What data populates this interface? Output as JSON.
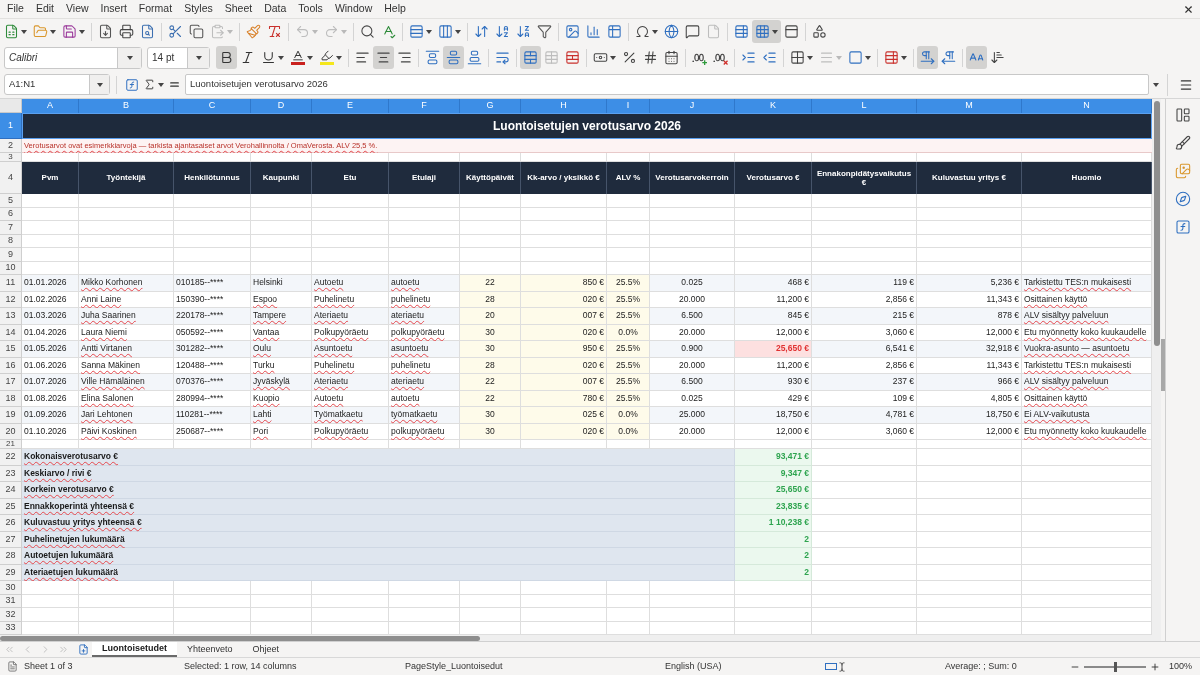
{
  "menu": [
    "File",
    "Edit",
    "View",
    "Insert",
    "Format",
    "Styles",
    "Sheet",
    "Data",
    "Tools",
    "Window",
    "Help"
  ],
  "standard_toolbar": {
    "disabled": {
      "paste": true,
      "undo": true,
      "redo": true,
      "headers_footers": true
    },
    "pressed": {
      "freeze_rows_columns": true
    }
  },
  "formatting_toolbar": {
    "font_name": "Calibri",
    "font_size": "14 pt",
    "pressed": {
      "bold": true,
      "italic": false,
      "underline": false,
      "align_left": false,
      "align_center": true,
      "align_right": false,
      "align_top": false,
      "center_vertically": true,
      "align_bottom": false,
      "wrap_text": false,
      "merge_and_center": true,
      "left_to_right": true,
      "right_to_left": false,
      "text_horizontal": true,
      "text_vertical": false
    },
    "disabled": {
      "merge_cells": true,
      "border_style": true
    }
  },
  "formula_bar": {
    "name_box": "A1:N1",
    "content": "Luontoisetujen verotusarvo 2026"
  },
  "sheet": {
    "columns": [
      {
        "letter": "A",
        "selected": true,
        "input": false
      },
      {
        "letter": "B",
        "selected": true,
        "input": false
      },
      {
        "letter": "C",
        "selected": true,
        "input": false
      },
      {
        "letter": "D",
        "selected": true,
        "input": false
      },
      {
        "letter": "E",
        "selected": true,
        "input": false
      },
      {
        "letter": "F",
        "selected": true,
        "input": false
      },
      {
        "letter": "G",
        "selected": true,
        "input": true
      },
      {
        "letter": "H",
        "selected": true,
        "input": true
      },
      {
        "letter": "I",
        "selected": true,
        "input": true
      },
      {
        "letter": "J",
        "selected": true,
        "input": false
      },
      {
        "letter": "K",
        "selected": true,
        "input": false
      },
      {
        "letter": "L",
        "selected": true,
        "input": false
      },
      {
        "letter": "M",
        "selected": true,
        "input": false
      },
      {
        "letter": "N",
        "selected": true,
        "input": false
      }
    ],
    "rows": [
      {
        "number": "1",
        "kind": "title",
        "selected": true,
        "text": "Luontoisetujen verotusarvo 2026"
      },
      {
        "number": "2",
        "kind": "note",
        "selected": false,
        "misspelled": true,
        "text": "Verotusarvot ovat esimerkkiarvoja — tarkista ajantasaiset arvot Verohallinnolta / OmaVerosta. ALV 25,5 %."
      },
      {
        "number": "3",
        "kind": "spacer",
        "selected": false
      },
      {
        "number": "4",
        "kind": "header",
        "selected": false,
        "cells": [
          "Pvm",
          "Työntekijä",
          "Henkilötunnus",
          "Kaupunki",
          "Etu",
          "Etulaji",
          "Käyttöpäivät",
          "Kk-arvo / yksikkö €",
          "ALV %",
          "Verotusarvokerroin",
          "Verotusarvo €",
          "Ennakonpidätysvaikutus €",
          "Kuluvastuu yritys €",
          "Huomio"
        ]
      },
      {
        "number": "5",
        "kind": "empty",
        "selected": false
      },
      {
        "number": "6",
        "kind": "empty",
        "selected": false
      },
      {
        "number": "7",
        "kind": "empty",
        "selected": false
      },
      {
        "number": "8",
        "kind": "empty",
        "selected": false
      },
      {
        "number": "9",
        "kind": "empty",
        "selected": false
      },
      {
        "number": "10",
        "kind": "empty",
        "selected": false
      },
      {
        "number": "11",
        "kind": "data",
        "selected": false,
        "shaded": true,
        "misspelled": [
          false,
          true,
          false,
          false,
          true,
          true,
          false,
          false,
          false,
          false,
          false,
          false,
          false,
          true
        ],
        "cells": [
          "01.01.2026",
          "Mikko Korhonen",
          "010185--****",
          "Helsinki",
          "Autoetu",
          "autoetu",
          "22",
          "850 €",
          "25.5%",
          "0.025",
          "468 €",
          "119 €",
          "5,236 €",
          "Tarkistettu TES:n mukaisesti"
        ]
      },
      {
        "number": "12",
        "kind": "data",
        "selected": false,
        "shaded": false,
        "misspelled": [
          false,
          true,
          false,
          true,
          true,
          true,
          false,
          false,
          false,
          false,
          false,
          false,
          false,
          true
        ],
        "cells": [
          "01.02.2026",
          "Anni Laine",
          "150390--****",
          "Espoo",
          "Puhelinetu",
          "puhelinetu",
          "28",
          "020 €",
          "25.5%",
          "20.000",
          "11,200 €",
          "2,856 €",
          "11,343 €",
          "Osittainen käyttö"
        ]
      },
      {
        "number": "13",
        "kind": "data",
        "selected": false,
        "shaded": true,
        "misspelled": [
          false,
          true,
          false,
          true,
          true,
          true,
          false,
          false,
          false,
          false,
          false,
          false,
          false,
          true
        ],
        "cells": [
          "01.03.2026",
          "Juha Saarinen",
          "220178--****",
          "Tampere",
          "Ateriaetu",
          "ateriaetu",
          "20",
          "007 €",
          "25.5%",
          "6.500",
          "845 €",
          "215 €",
          "878 €",
          "ALV sisältyy palveluun"
        ]
      },
      {
        "number": "14",
        "kind": "data",
        "selected": false,
        "shaded": false,
        "misspelled": [
          false,
          true,
          false,
          true,
          true,
          true,
          false,
          false,
          false,
          false,
          false,
          false,
          false,
          true
        ],
        "cells": [
          "01.04.2026",
          "Laura Niemi",
          "050592--****",
          "Vantaa",
          "Polkupyöräetu",
          "polkupyöräetu",
          "30",
          "020 €",
          "0.0%",
          "20.000",
          "12,000 €",
          "3,060 €",
          "12,000 €",
          "Etu myönnetty koko kuukaudelle"
        ]
      },
      {
        "number": "15",
        "kind": "data",
        "selected": false,
        "shaded": true,
        "misspelled": [
          false,
          true,
          false,
          true,
          true,
          true,
          false,
          false,
          false,
          false,
          false,
          false,
          false,
          true
        ],
        "alert": [
          false,
          false,
          false,
          false,
          false,
          false,
          false,
          false,
          false,
          false,
          true,
          false,
          false,
          false
        ],
        "cells": [
          "01.05.2026",
          "Antti Virtanen",
          "301282--****",
          "Oulu",
          "Asuntoetu",
          "asuntoetu",
          "30",
          "950 €",
          "25.5%",
          "0.900",
          "25,650 €",
          "6,541 €",
          "32,918 €",
          "Vuokra-asunto — asuntoetu"
        ]
      },
      {
        "number": "16",
        "kind": "data",
        "selected": false,
        "shaded": false,
        "misspelled": [
          false,
          true,
          false,
          true,
          true,
          true,
          false,
          false,
          false,
          false,
          false,
          false,
          false,
          true
        ],
        "cells": [
          "01.06.2026",
          "Sanna Mäkinen",
          "120488--****",
          "Turku",
          "Puhelinetu",
          "puhelinetu",
          "28",
          "020 €",
          "25.5%",
          "20.000",
          "11,200 €",
          "2,856 €",
          "11,343 €",
          "Tarkistettu TES:n mukaisesti"
        ]
      },
      {
        "number": "17",
        "kind": "data",
        "selected": false,
        "shaded": true,
        "misspelled": [
          false,
          true,
          false,
          true,
          true,
          true,
          false,
          false,
          false,
          false,
          false,
          false,
          false,
          true
        ],
        "cells": [
          "01.07.2026",
          "Ville Hämäläinen",
          "070376--****",
          "Jyväskylä",
          "Ateriaetu",
          "ateriaetu",
          "22",
          "007 €",
          "25.5%",
          "6.500",
          "930 €",
          "237 €",
          "966 €",
          "ALV sisältyy palveluun"
        ]
      },
      {
        "number": "18",
        "kind": "data",
        "selected": false,
        "shaded": false,
        "misspelled": [
          false,
          true,
          false,
          true,
          true,
          true,
          false,
          false,
          false,
          false,
          false,
          false,
          false,
          true
        ],
        "cells": [
          "01.08.2026",
          "Elina Salonen",
          "280994--****",
          "Kuopio",
          "Autoetu",
          "autoetu",
          "22",
          "780 €",
          "25.5%",
          "0.025",
          "429 €",
          "109 €",
          "4,805 €",
          "Osittainen käyttö"
        ]
      },
      {
        "number": "19",
        "kind": "data",
        "selected": false,
        "shaded": true,
        "misspelled": [
          false,
          true,
          false,
          true,
          true,
          true,
          false,
          false,
          false,
          false,
          false,
          false,
          false,
          true
        ],
        "cells": [
          "01.09.2026",
          "Jari Lehtonen",
          "110281--****",
          "Lahti",
          "Työmatkaetu",
          "työmatkaetu",
          "30",
          "025 €",
          "0.0%",
          "25.000",
          "18,750 €",
          "4,781 €",
          "18,750 €",
          "Ei ALV-vaikutusta"
        ]
      },
      {
        "number": "20",
        "kind": "data",
        "selected": false,
        "shaded": false,
        "misspelled": [
          false,
          true,
          false,
          true,
          true,
          true,
          false,
          false,
          false,
          false,
          false,
          false,
          false,
          true
        ],
        "cells": [
          "01.10.2026",
          "Päivi Koskinen",
          "250687--****",
          "Pori",
          "Polkupyöräetu",
          "polkupyöräetu",
          "30",
          "020 €",
          "0.0%",
          "20.000",
          "12,000 €",
          "3,060 €",
          "12,000 €",
          "Etu myönnetty koko kuukaudelle"
        ]
      },
      {
        "number": "21",
        "kind": "spacer",
        "selected": false
      },
      {
        "number": "22",
        "kind": "summary",
        "selected": false,
        "misspelled": true,
        "label": "Kokonaisverotusarvo €",
        "value": "93,471 €"
      },
      {
        "number": "23",
        "kind": "summary",
        "selected": false,
        "misspelled": true,
        "label": "Keskiarvo / rivi €",
        "value": "9,347 €"
      },
      {
        "number": "24",
        "kind": "summary",
        "selected": false,
        "misspelled": true,
        "label": "Korkein verotusarvo €",
        "value": "25,650 €"
      },
      {
        "number": "25",
        "kind": "summary",
        "selected": false,
        "misspelled": true,
        "label": "Ennakkoperintä yhteensä €",
        "value": "23,835 €"
      },
      {
        "number": "26",
        "kind": "summary",
        "selected": false,
        "misspelled": true,
        "label": "Kuluvastuu yritys yhteensä €",
        "value": "1 10,238 €"
      },
      {
        "number": "27",
        "kind": "summary",
        "selected": false,
        "misspelled": true,
        "label": "Puhelinetujen lukumäärä",
        "value": "2"
      },
      {
        "number": "28",
        "kind": "summary",
        "selected": false,
        "misspelled": true,
        "label": "Autoetujen lukumäärä",
        "value": "2"
      },
      {
        "number": "29",
        "kind": "summary",
        "selected": false,
        "misspelled": true,
        "label": "Ateriaetujen lukumäärä",
        "value": "2"
      },
      {
        "number": "30",
        "kind": "empty",
        "selected": false
      },
      {
        "number": "31",
        "kind": "empty",
        "selected": false
      },
      {
        "number": "32",
        "kind": "empty",
        "selected": false
      },
      {
        "number": "33",
        "kind": "empty",
        "selected": false
      }
    ]
  },
  "sheet_tabs": {
    "navigation_disabled": true,
    "tabs": [
      {
        "label": "Luontoisetudet",
        "selected": true
      },
      {
        "label": "Yhteenveto",
        "selected": false
      },
      {
        "label": "Ohjeet",
        "selected": false
      }
    ]
  },
  "status_bar": {
    "sheet_position": "Sheet 1 of 3",
    "selection": "Selected: 1 row, 14 columns",
    "page_style": "PageStyle_Luontoisedut",
    "language": "English (USA)",
    "aggregate": "Average: ; Sum: 0",
    "zoom": {
      "level": 0.5,
      "reading": "100%"
    }
  }
}
